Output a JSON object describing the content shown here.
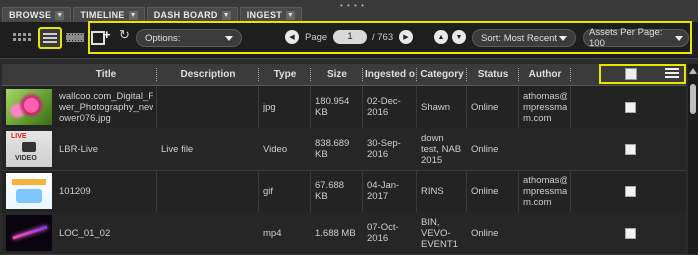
{
  "tabs": [
    {
      "label": "BROWSE"
    },
    {
      "label": "TIMELINE"
    },
    {
      "label": "DASH BOARD"
    },
    {
      "label": "INGEST"
    }
  ],
  "toolbar": {
    "options_label": "Options:",
    "page_label": "Page",
    "page_value": "1",
    "page_total": "/ 763",
    "sort_label": "Sort: Most Recent",
    "assets_per_page": "Assets Per Page: 100"
  },
  "table": {
    "columns": [
      "Title",
      "Description",
      "Type",
      "Size",
      "Ingested o",
      "Category",
      "Status",
      "Author"
    ],
    "rows": [
      {
        "title": "wallcoo.com_Digital_Flower_Photography_newflower076.jpg",
        "title_lines": [
          "wallcoo.com_Digital_Flo",
          "wer_Photography_newfl",
          "ower076.jpg"
        ],
        "description": "",
        "type": "jpg",
        "size": "180.954 KB",
        "ingested": "02-Dec-2016",
        "category": "Shawn",
        "status": "Online",
        "author": "athomas@empressmam.com",
        "author_lines": [
          "athomas@e",
          "mpressma",
          "m.com"
        ]
      },
      {
        "title": "LBR-Live",
        "title_lines": [
          "LBR-Live"
        ],
        "description": "Live file",
        "type": "Video",
        "size": "838.689 KB",
        "ingested": "30-Sep-2016",
        "category": "down test, NAB 2015",
        "status": "Online",
        "author": "",
        "author_lines": []
      },
      {
        "title": "101209",
        "title_lines": [
          "101209"
        ],
        "description": "",
        "type": "gif",
        "size": "67.688 KB",
        "ingested": "04-Jan-2017",
        "category": "RINS",
        "status": "Online",
        "author": "athomas@empressmam.com",
        "author_lines": [
          "athomas@e",
          "mpressma",
          "m.com"
        ]
      },
      {
        "title": "LOC_01_02",
        "title_lines": [
          "LOC_01_02"
        ],
        "description": "",
        "type": "mp4",
        "size": "1.688 MB",
        "ingested": "07-Oct-2016",
        "category": "BIN, VEVO-EVENT1",
        "status": "Online",
        "author": "",
        "author_lines": []
      }
    ],
    "video_thumb_text": "VIDEO",
    "live_badge": "LIVE"
  },
  "colors": {
    "highlight": "#e6e600",
    "background": "#2b2b2b"
  }
}
